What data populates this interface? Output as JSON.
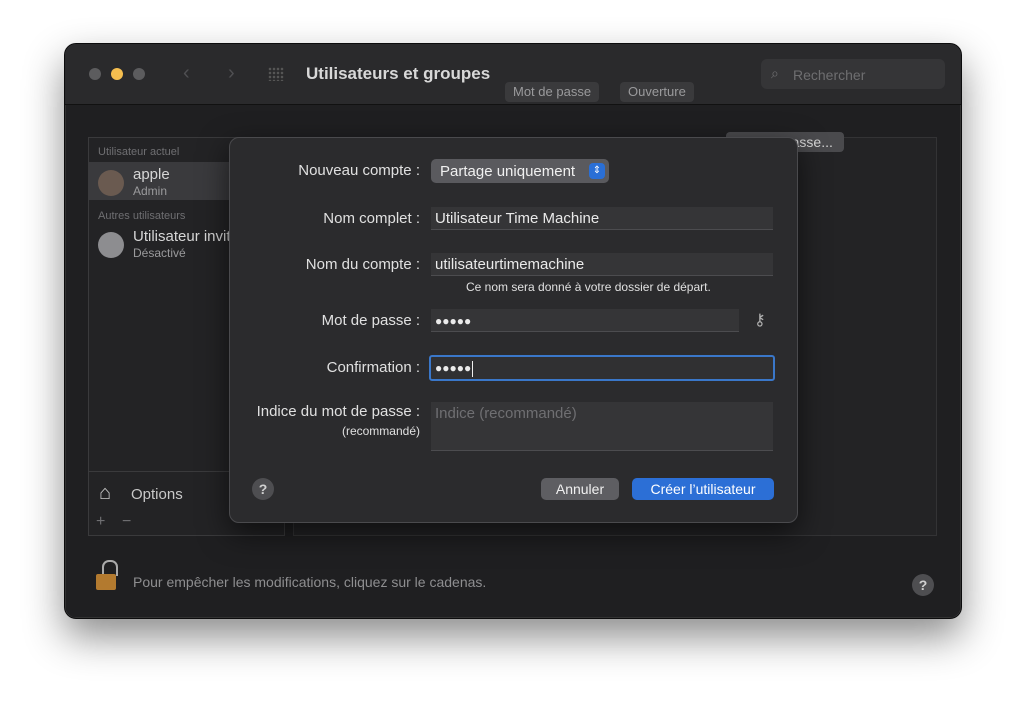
{
  "window": {
    "title": "Utilisateurs et groupes",
    "search_placeholder": "Rechercher",
    "nav_back": "‹",
    "nav_forward": "›"
  },
  "sidebar": {
    "current_header": "Utilisateur actuel",
    "current_user": {
      "name": "apple",
      "role": "Admin"
    },
    "others_header": "Autres utilisateurs",
    "other_users": [
      {
        "name": "Utilisateur invité",
        "role": "Désactivé"
      }
    ],
    "options_label": "Options",
    "add_label": "+",
    "remove_label": "−"
  },
  "main": {
    "tabs": [
      "Mot de passe",
      "Ouverture"
    ],
    "change_password_label": "mot de passe..."
  },
  "footer": {
    "lock_text": "Pour empêcher les modifications, cliquez sur le cadenas.",
    "help_label": "?"
  },
  "sheet": {
    "account_type_label": "Nouveau compte :",
    "account_type_value": "Partage uniquement",
    "full_name_label": "Nom complet :",
    "full_name_value": "Utilisateur Time Machine",
    "account_name_label": "Nom du compte :",
    "account_name_value": "utilisateurtimemachine",
    "account_name_note": "Ce nom sera donné à votre dossier de départ.",
    "password_label": "Mot de passe :",
    "password_value": "●●●●●",
    "confirm_label": "Confirmation :",
    "confirm_value": "●●●●●",
    "hint_label": "Indice du mot de passe :",
    "hint_sublabel": "(recommandé)",
    "hint_placeholder": "Indice (recommandé)",
    "help_label": "?",
    "cancel_label": "Annuler",
    "create_label": "Créer l’utilisateur"
  },
  "colors": {
    "accent": "#2c6fd6",
    "window_bg": "#1f1f21",
    "sheet_bg": "#2b2b2d",
    "lock": "#b37a2f"
  }
}
